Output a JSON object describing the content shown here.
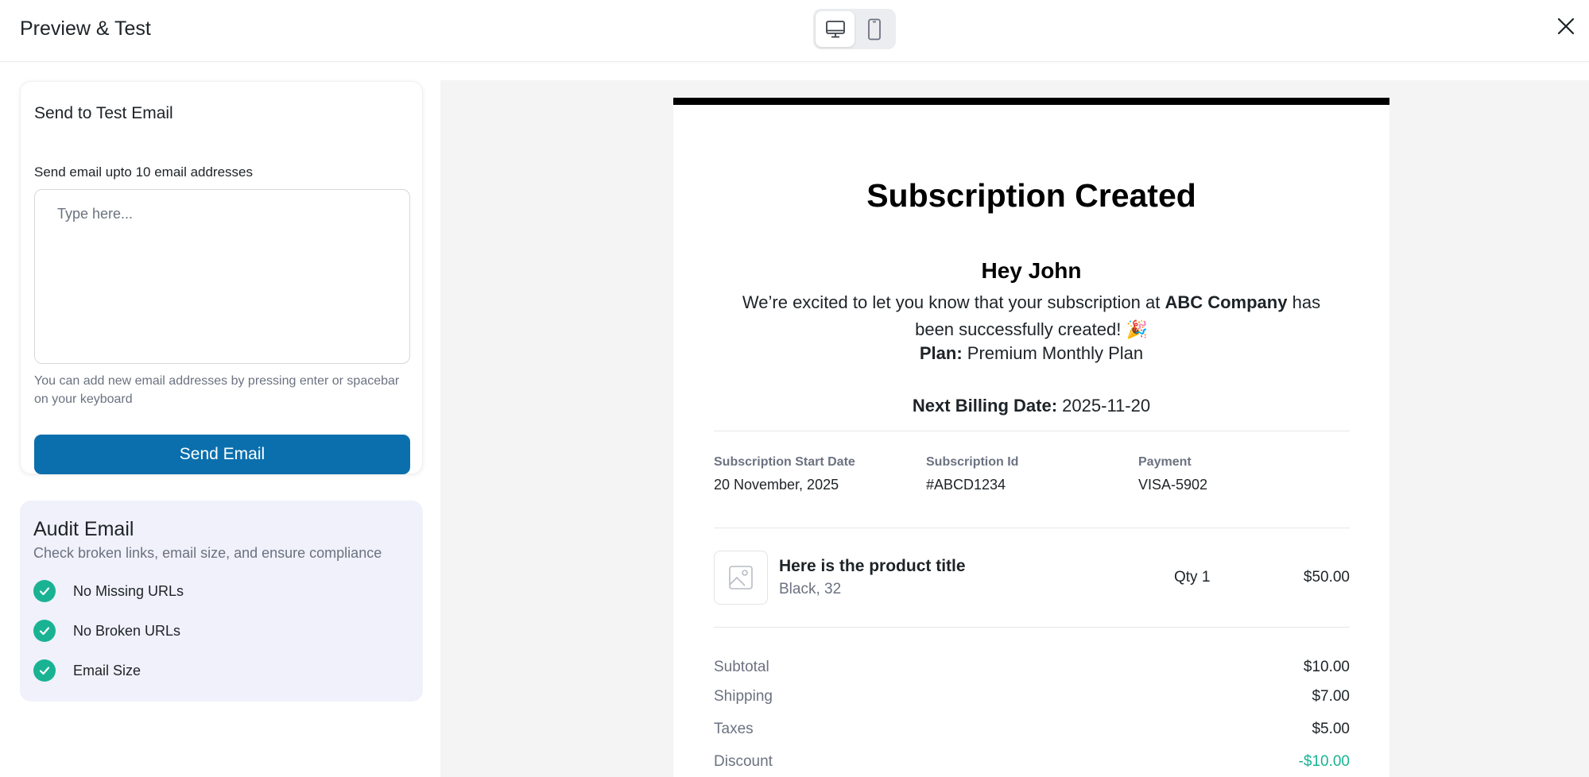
{
  "header": {
    "title": "Preview & Test",
    "device_desktop": "desktop-icon",
    "device_mobile": "mobile-icon",
    "close": "close-icon"
  },
  "test_email": {
    "heading": "Send to Test Email",
    "label": "Send email upto 10 email addresses",
    "placeholder": "Type here...",
    "help": "You can add new email addresses by pressing enter or spacebar on your keyboard",
    "button": "Send Email"
  },
  "audit": {
    "heading": "Audit Email",
    "subtitle": "Check broken links, email size, and ensure compliance",
    "items": [
      {
        "label": "No Missing URLs"
      },
      {
        "label": "No Broken URLs"
      },
      {
        "label": "Email Size"
      }
    ]
  },
  "email": {
    "title": "Subscription Created",
    "greeting": "Hey John",
    "body_pre": "We’re excited to let you know that your subscription at",
    "company": "ABC Company",
    "body_post": "has been successfully created!",
    "emoji": "🎉",
    "plan_label": "Plan:",
    "plan_value": "Premium Monthly Plan",
    "billing_label": "Next Billing Date:",
    "billing_value": "2025-11-20",
    "meta": [
      {
        "label": "Subscription Start Date",
        "value": "20 November, 2025"
      },
      {
        "label": "Subscription Id",
        "value": "#ABCD1234"
      },
      {
        "label": "Payment",
        "value": "VISA-5902"
      }
    ],
    "product": {
      "title": "Here is the product title",
      "variant": "Black, 32",
      "qty": "Qty 1",
      "price": "$50.00"
    },
    "totals": [
      {
        "label": "Subtotal",
        "value": "$10.00"
      },
      {
        "label": "Shipping",
        "value": "$7.00"
      },
      {
        "label": "Taxes",
        "value": "$5.00"
      },
      {
        "label": "Discount",
        "value": "-$10.00"
      }
    ]
  },
  "colors": {
    "primary_button": "#0b6fad",
    "check_green": "#19b394",
    "audit_bg": "#f0f1fa",
    "preview_bg": "#f4f4f5"
  }
}
